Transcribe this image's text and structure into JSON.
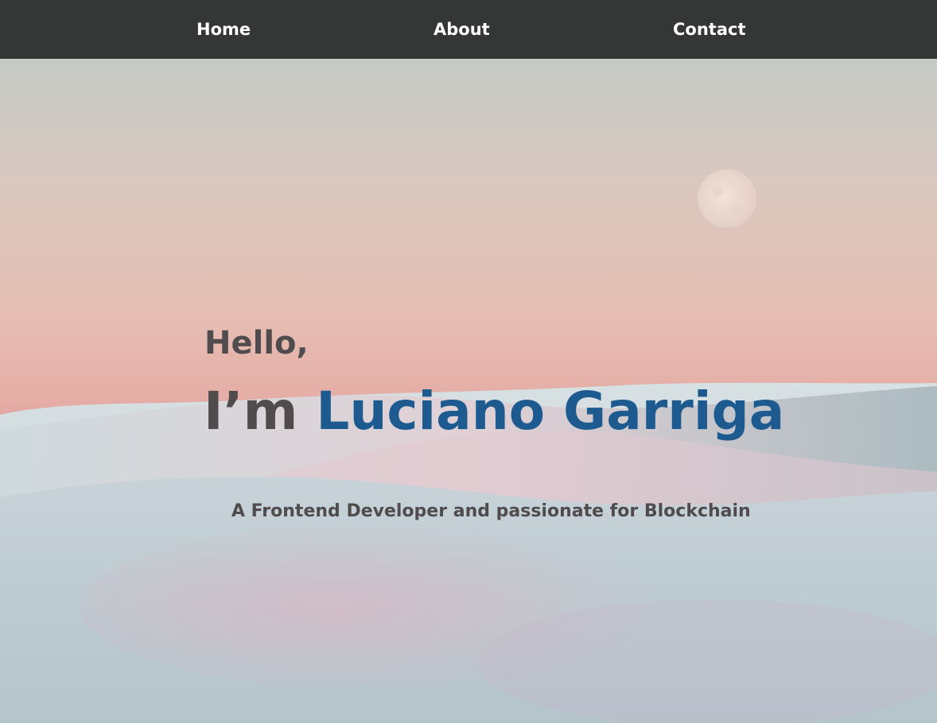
{
  "nav": {
    "items": [
      {
        "label": "Home"
      },
      {
        "label": "About"
      },
      {
        "label": "Contact"
      }
    ]
  },
  "hero": {
    "greeting": "Hello,",
    "intro_prefix": "I’m",
    "name": "Luciano Garriga",
    "tagline": "A Frontend Developer and passionate for Blockchain",
    "background_image": "desert-dunes-with-moon-photo"
  },
  "colors": {
    "nav_bg": "#353636",
    "nav_text": "#ffffff",
    "heading_text": "#504c4d",
    "name_accent": "#1d5a8f"
  }
}
